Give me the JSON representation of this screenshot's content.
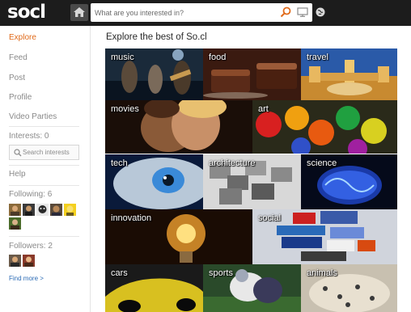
{
  "app": {
    "logo": "socl"
  },
  "topbar": {
    "search_placeholder": "What are you interested in?",
    "icons": [
      "home-icon",
      "search-icon",
      "monitor-icon",
      "globe-icon"
    ]
  },
  "sidebar": {
    "nav": [
      {
        "label": "Explore",
        "active": true
      },
      {
        "label": "Feed"
      },
      {
        "label": "Post"
      },
      {
        "label": "Profile"
      },
      {
        "label": "Video Parties"
      }
    ],
    "interests_label": "Interests: 0",
    "search_interests_placeholder": "Search interests",
    "help": "Help",
    "following_label": "Following: 6",
    "followers_label": "Followers: 2",
    "find_more": "Find more >"
  },
  "main": {
    "title": "Explore the best of So.cl",
    "tiles": [
      {
        "label": "music"
      },
      {
        "label": "food"
      },
      {
        "label": "travel"
      },
      {
        "label": "movies"
      },
      {
        "label": "art"
      },
      {
        "label": "tech"
      },
      {
        "label": "architecture"
      },
      {
        "label": "science"
      },
      {
        "label": "innovation"
      },
      {
        "label": "social"
      },
      {
        "label": "cars"
      },
      {
        "label": "sports"
      },
      {
        "label": "animals"
      }
    ]
  },
  "colors": {
    "accent": "#e06a1a",
    "topbar": "#1c1c1c",
    "link": "#2b6bb5"
  }
}
